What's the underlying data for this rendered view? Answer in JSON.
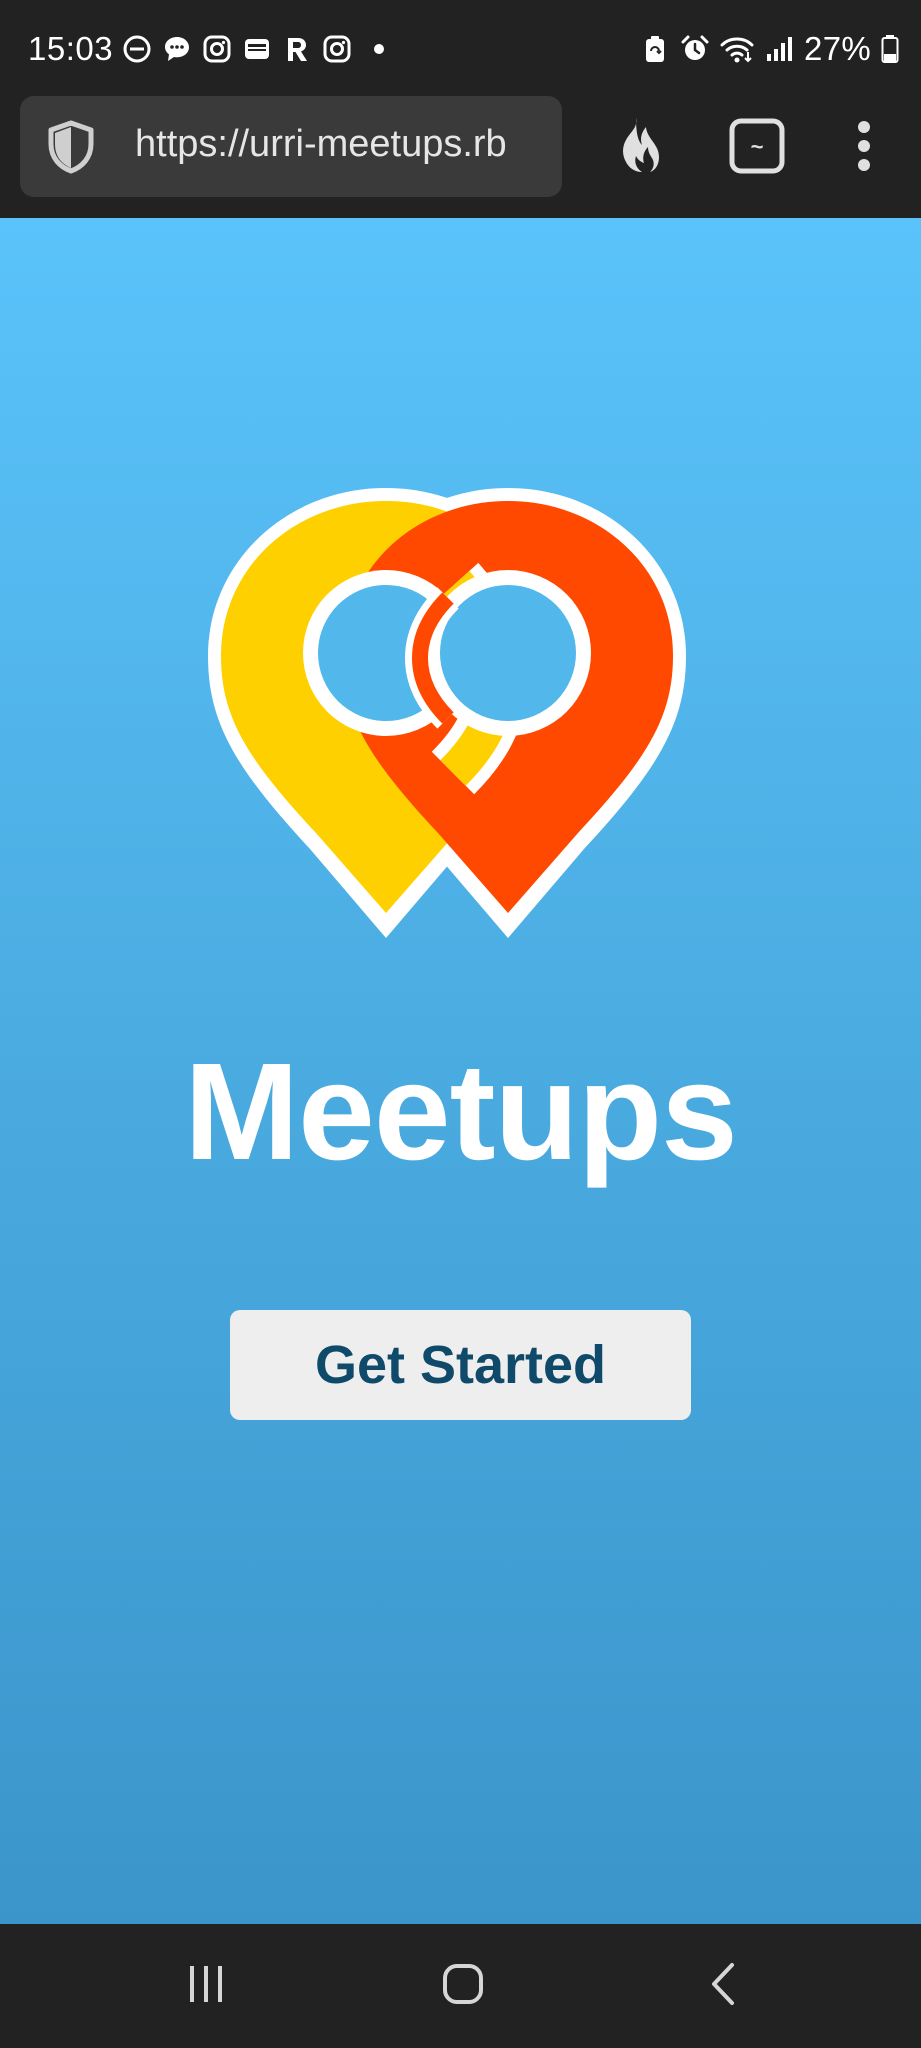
{
  "status_bar": {
    "time": "15:03",
    "battery_percent": "27%",
    "notification_icons": [
      "do-not-disturb-icon",
      "chat-bubble-icon",
      "instagram-icon",
      "wallet-icon",
      "r-app-icon",
      "instagram-icon"
    ],
    "system_icons": [
      "battery-saver-icon",
      "alarm-icon",
      "wifi-icon",
      "signal-icon",
      "battery-icon"
    ]
  },
  "browser": {
    "url": "https://urri-meetups.rb",
    "shield_icon": "shield-icon",
    "actions": [
      "fire-icon",
      "tab-switcher-icon",
      "more-menu-icon"
    ],
    "tab_count_label": "~"
  },
  "page": {
    "title": "Meetups",
    "cta_label": "Get Started",
    "logo": "overlapping-map-pins-logo",
    "colors": {
      "background_top": "#5ac3fa",
      "background_bottom": "#3b95cb",
      "pin_yellow": "#ffd000",
      "pin_orange": "#ff4800",
      "button_background": "#eeeeee",
      "button_text": "#0f4a6b"
    }
  },
  "nav_bar": {
    "buttons": [
      "recents-icon",
      "home-icon",
      "back-icon"
    ]
  }
}
